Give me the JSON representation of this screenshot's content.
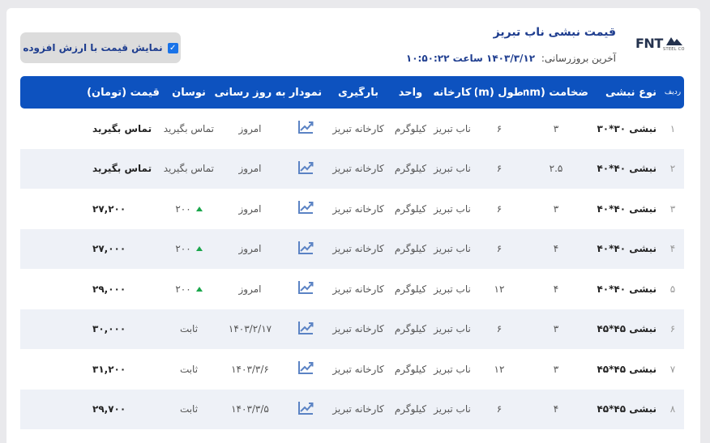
{
  "header": {
    "title": "قیمت نبشی ناب تبریز",
    "updated_label": "آخرین بروزرسانی:",
    "updated_value": "۱۴۰۳/۳/۱۲ ساعت ۱۰:۵۰:۲۲",
    "vat_label": "نمایش قیمت با ارزش افزوده",
    "vat_checked": true,
    "logo_text": "FNT",
    "logo_sub": "STEEL CO"
  },
  "table": {
    "columns": {
      "index": "ردیف",
      "type": "نوع نبشی",
      "thickness": "ضخامت (mm)",
      "length": "طول (m)",
      "factory": "کارخانه",
      "unit": "واحد",
      "loading": "بارگیری",
      "chart": "نمودار",
      "updated": "به روز رسانی",
      "change": "نوسان",
      "price": "قیمت (تومان)"
    },
    "rows": [
      {
        "index": "۱",
        "type": "نبشی ۳۰*۳۰",
        "thickness": "۳",
        "length": "۶",
        "factory": "ناب تبریز",
        "unit": "کیلوگرم",
        "loading": "کارخانه تبریز",
        "updated": "امروز",
        "change": "تماس بگیرید",
        "change_dir": "none",
        "price": "تماس بگیرید"
      },
      {
        "index": "۲",
        "type": "نبشی ۴۰*۴۰",
        "thickness": "۲.۵",
        "length": "۶",
        "factory": "ناب تبریز",
        "unit": "کیلوگرم",
        "loading": "کارخانه تبریز",
        "updated": "امروز",
        "change": "تماس بگیرید",
        "change_dir": "none",
        "price": "تماس بگیرید"
      },
      {
        "index": "۳",
        "type": "نبشی ۴۰*۴۰",
        "thickness": "۳",
        "length": "۶",
        "factory": "ناب تبریز",
        "unit": "کیلوگرم",
        "loading": "کارخانه تبریز",
        "updated": "امروز",
        "change": "۲۰۰",
        "change_dir": "up",
        "price": "۲۷,۲۰۰"
      },
      {
        "index": "۴",
        "type": "نبشی ۴۰*۴۰",
        "thickness": "۴",
        "length": "۶",
        "factory": "ناب تبریز",
        "unit": "کیلوگرم",
        "loading": "کارخانه تبریز",
        "updated": "امروز",
        "change": "۲۰۰",
        "change_dir": "up",
        "price": "۲۷,۰۰۰"
      },
      {
        "index": "۵",
        "type": "نبشی ۴۰*۴۰",
        "thickness": "۴",
        "length": "۱۲",
        "factory": "ناب تبریز",
        "unit": "کیلوگرم",
        "loading": "کارخانه تبریز",
        "updated": "امروز",
        "change": "۲۰۰",
        "change_dir": "up",
        "price": "۲۹,۰۰۰"
      },
      {
        "index": "۶",
        "type": "نبشی ۴۵*۴۵",
        "thickness": "۳",
        "length": "۶",
        "factory": "ناب تبریز",
        "unit": "کیلوگرم",
        "loading": "کارخانه تبریز",
        "updated": "۱۴۰۳/۲/۱۷",
        "change": "ثابت",
        "change_dir": "none",
        "price": "۳۰,۰۰۰"
      },
      {
        "index": "۷",
        "type": "نبشی ۴۵*۴۵",
        "thickness": "۳",
        "length": "۱۲",
        "factory": "ناب تبریز",
        "unit": "کیلوگرم",
        "loading": "کارخانه تبریز",
        "updated": "۱۴۰۳/۳/۶",
        "change": "ثابت",
        "change_dir": "none",
        "price": "۳۱,۲۰۰"
      },
      {
        "index": "۸",
        "type": "نبشی ۴۵*۴۵",
        "thickness": "۴",
        "length": "۶",
        "factory": "ناب تبریز",
        "unit": "کیلوگرم",
        "loading": "کارخانه تبریز",
        "updated": "۱۴۰۳/۳/۵",
        "change": "ثابت",
        "change_dir": "none",
        "price": "۲۹,۷۰۰"
      }
    ]
  },
  "icons": {
    "chart": "trending-chart-icon",
    "logo": "fnt-logo-icon"
  },
  "colors": {
    "accent": "#0d52bf",
    "title": "#1e3d8f",
    "up": "#1aa64b",
    "row_alt": "#eef1f7",
    "chart_icon": "#5b83c4"
  }
}
